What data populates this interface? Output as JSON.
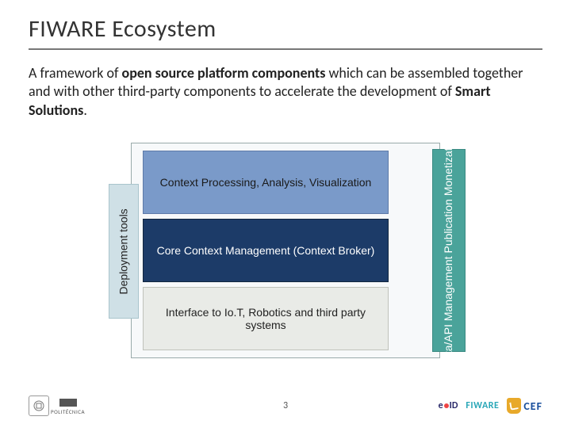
{
  "title": "FIWARE Ecosystem",
  "description": {
    "part1": "A framework of ",
    "bold1": "open source platform components",
    "part2": " which can be assembled together and with other third-party components to accelerate the development of ",
    "bold2": "Smart Solutions",
    "part3": "."
  },
  "diagram": {
    "left_bar": "Deployment tools",
    "row1": "Context Processing, Analysis, Visualization",
    "row2": "Core Context Management (Context Broker)",
    "row3": "Interface to Io.T, Robotics and third party systems",
    "right_bar": "Data/API Management Publication Monetization"
  },
  "footer": {
    "page_number": "3",
    "left_logo_text": "POLITÉCNICA",
    "eid_e": "e",
    "eid_id": "ID",
    "fiware": "FIWARE",
    "cef": "CEF"
  }
}
